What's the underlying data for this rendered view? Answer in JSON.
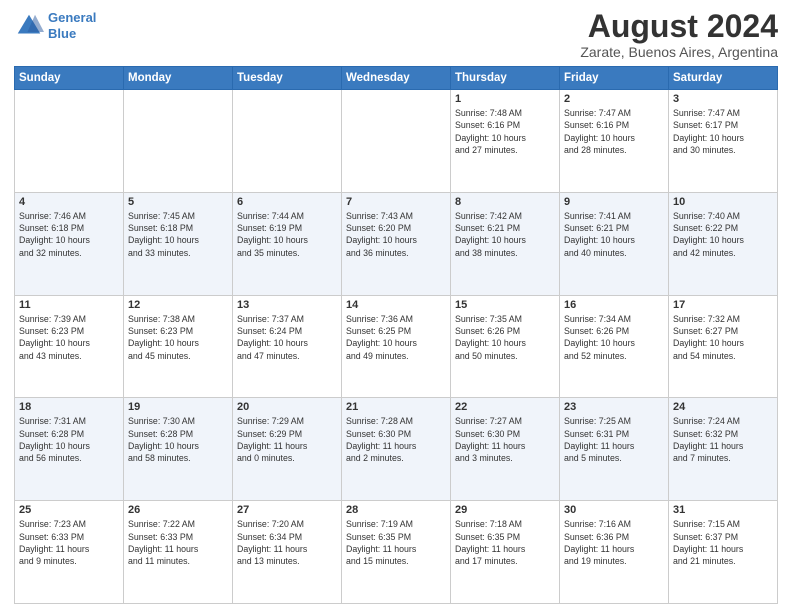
{
  "logo": {
    "line1": "General",
    "line2": "Blue"
  },
  "title": "August 2024",
  "location": "Zarate, Buenos Aires, Argentina",
  "days_of_week": [
    "Sunday",
    "Monday",
    "Tuesday",
    "Wednesday",
    "Thursday",
    "Friday",
    "Saturday"
  ],
  "weeks": [
    [
      {
        "day": "",
        "info": ""
      },
      {
        "day": "",
        "info": ""
      },
      {
        "day": "",
        "info": ""
      },
      {
        "day": "",
        "info": ""
      },
      {
        "day": "1",
        "info": "Sunrise: 7:48 AM\nSunset: 6:16 PM\nDaylight: 10 hours\nand 27 minutes."
      },
      {
        "day": "2",
        "info": "Sunrise: 7:47 AM\nSunset: 6:16 PM\nDaylight: 10 hours\nand 28 minutes."
      },
      {
        "day": "3",
        "info": "Sunrise: 7:47 AM\nSunset: 6:17 PM\nDaylight: 10 hours\nand 30 minutes."
      }
    ],
    [
      {
        "day": "4",
        "info": "Sunrise: 7:46 AM\nSunset: 6:18 PM\nDaylight: 10 hours\nand 32 minutes."
      },
      {
        "day": "5",
        "info": "Sunrise: 7:45 AM\nSunset: 6:18 PM\nDaylight: 10 hours\nand 33 minutes."
      },
      {
        "day": "6",
        "info": "Sunrise: 7:44 AM\nSunset: 6:19 PM\nDaylight: 10 hours\nand 35 minutes."
      },
      {
        "day": "7",
        "info": "Sunrise: 7:43 AM\nSunset: 6:20 PM\nDaylight: 10 hours\nand 36 minutes."
      },
      {
        "day": "8",
        "info": "Sunrise: 7:42 AM\nSunset: 6:21 PM\nDaylight: 10 hours\nand 38 minutes."
      },
      {
        "day": "9",
        "info": "Sunrise: 7:41 AM\nSunset: 6:21 PM\nDaylight: 10 hours\nand 40 minutes."
      },
      {
        "day": "10",
        "info": "Sunrise: 7:40 AM\nSunset: 6:22 PM\nDaylight: 10 hours\nand 42 minutes."
      }
    ],
    [
      {
        "day": "11",
        "info": "Sunrise: 7:39 AM\nSunset: 6:23 PM\nDaylight: 10 hours\nand 43 minutes."
      },
      {
        "day": "12",
        "info": "Sunrise: 7:38 AM\nSunset: 6:23 PM\nDaylight: 10 hours\nand 45 minutes."
      },
      {
        "day": "13",
        "info": "Sunrise: 7:37 AM\nSunset: 6:24 PM\nDaylight: 10 hours\nand 47 minutes."
      },
      {
        "day": "14",
        "info": "Sunrise: 7:36 AM\nSunset: 6:25 PM\nDaylight: 10 hours\nand 49 minutes."
      },
      {
        "day": "15",
        "info": "Sunrise: 7:35 AM\nSunset: 6:26 PM\nDaylight: 10 hours\nand 50 minutes."
      },
      {
        "day": "16",
        "info": "Sunrise: 7:34 AM\nSunset: 6:26 PM\nDaylight: 10 hours\nand 52 minutes."
      },
      {
        "day": "17",
        "info": "Sunrise: 7:32 AM\nSunset: 6:27 PM\nDaylight: 10 hours\nand 54 minutes."
      }
    ],
    [
      {
        "day": "18",
        "info": "Sunrise: 7:31 AM\nSunset: 6:28 PM\nDaylight: 10 hours\nand 56 minutes."
      },
      {
        "day": "19",
        "info": "Sunrise: 7:30 AM\nSunset: 6:28 PM\nDaylight: 10 hours\nand 58 minutes."
      },
      {
        "day": "20",
        "info": "Sunrise: 7:29 AM\nSunset: 6:29 PM\nDaylight: 11 hours\nand 0 minutes."
      },
      {
        "day": "21",
        "info": "Sunrise: 7:28 AM\nSunset: 6:30 PM\nDaylight: 11 hours\nand 2 minutes."
      },
      {
        "day": "22",
        "info": "Sunrise: 7:27 AM\nSunset: 6:30 PM\nDaylight: 11 hours\nand 3 minutes."
      },
      {
        "day": "23",
        "info": "Sunrise: 7:25 AM\nSunset: 6:31 PM\nDaylight: 11 hours\nand 5 minutes."
      },
      {
        "day": "24",
        "info": "Sunrise: 7:24 AM\nSunset: 6:32 PM\nDaylight: 11 hours\nand 7 minutes."
      }
    ],
    [
      {
        "day": "25",
        "info": "Sunrise: 7:23 AM\nSunset: 6:33 PM\nDaylight: 11 hours\nand 9 minutes."
      },
      {
        "day": "26",
        "info": "Sunrise: 7:22 AM\nSunset: 6:33 PM\nDaylight: 11 hours\nand 11 minutes."
      },
      {
        "day": "27",
        "info": "Sunrise: 7:20 AM\nSunset: 6:34 PM\nDaylight: 11 hours\nand 13 minutes."
      },
      {
        "day": "28",
        "info": "Sunrise: 7:19 AM\nSunset: 6:35 PM\nDaylight: 11 hours\nand 15 minutes."
      },
      {
        "day": "29",
        "info": "Sunrise: 7:18 AM\nSunset: 6:35 PM\nDaylight: 11 hours\nand 17 minutes."
      },
      {
        "day": "30",
        "info": "Sunrise: 7:16 AM\nSunset: 6:36 PM\nDaylight: 11 hours\nand 19 minutes."
      },
      {
        "day": "31",
        "info": "Sunrise: 7:15 AM\nSunset: 6:37 PM\nDaylight: 11 hours\nand 21 minutes."
      }
    ]
  ]
}
